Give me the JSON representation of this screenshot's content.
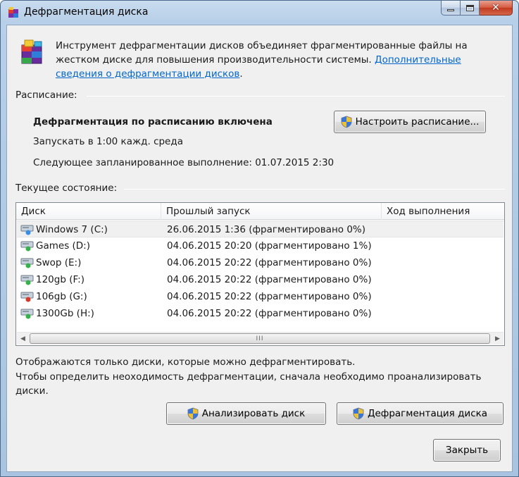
{
  "window": {
    "title": "Дефрагментация диска",
    "close_glyph": "✕"
  },
  "intro": {
    "text": "Инструмент дефрагментации дисков объединяет фрагментированные файлы на жестком диске для повышения производительности системы. ",
    "link": "Дополнительные сведения о дефрагментации дисков",
    "after_link": "."
  },
  "schedule": {
    "group_label": "Расписание:",
    "status": "Дефрагментация по расписанию включена",
    "run_at": "Запускать в 1:00 кажд. среда",
    "next_run": "Следующее запланированное выполнение: 01.07.2015 2:30",
    "configure_button": "Настроить расписание..."
  },
  "current_state": {
    "group_label": "Текущее состояние:",
    "columns": [
      "Диск",
      "Прошлый запуск",
      "Ход выполнения"
    ],
    "rows": [
      {
        "disk": "Windows 7 (C:)",
        "last_run": "26.06.2015 1:36 (фрагментировано 0%)",
        "progress": "",
        "icon_color": "#3a8ee6"
      },
      {
        "disk": "Games (D:)",
        "last_run": "04.06.2015 20:20 (фрагментировано 1%)",
        "progress": "",
        "icon_color": "#36b24a"
      },
      {
        "disk": "Swop (E:)",
        "last_run": "04.06.2015 20:22 (фрагментировано 0%)",
        "progress": "",
        "icon_color": "#36b24a"
      },
      {
        "disk": "120gb (F:)",
        "last_run": "04.06.2015 20:22 (фрагментировано 0%)",
        "progress": "",
        "icon_color": "#36b24a"
      },
      {
        "disk": "106gb (G:)",
        "last_run": "04.06.2015 20:22 (фрагментировано 0%)",
        "progress": "",
        "icon_color": "#d63a2b"
      },
      {
        "disk": "1300Gb (H:)",
        "last_run": "04.06.2015 20:22 (фрагментировано 0%)",
        "progress": "",
        "icon_color": "#36b24a"
      }
    ],
    "scroll_left": "◀",
    "scroll_right": "▶",
    "scroll_grip": "III"
  },
  "notes": {
    "line1": "Отображаются только диски, которые можно дефрагментировать.",
    "line2": "Чтобы определить неоходимость  дефрагментации, сначала необходимо проанализировать диски."
  },
  "buttons": {
    "analyze": "Анализировать диск",
    "defragment": "Дефрагментация диска",
    "close": "Закрыть"
  }
}
